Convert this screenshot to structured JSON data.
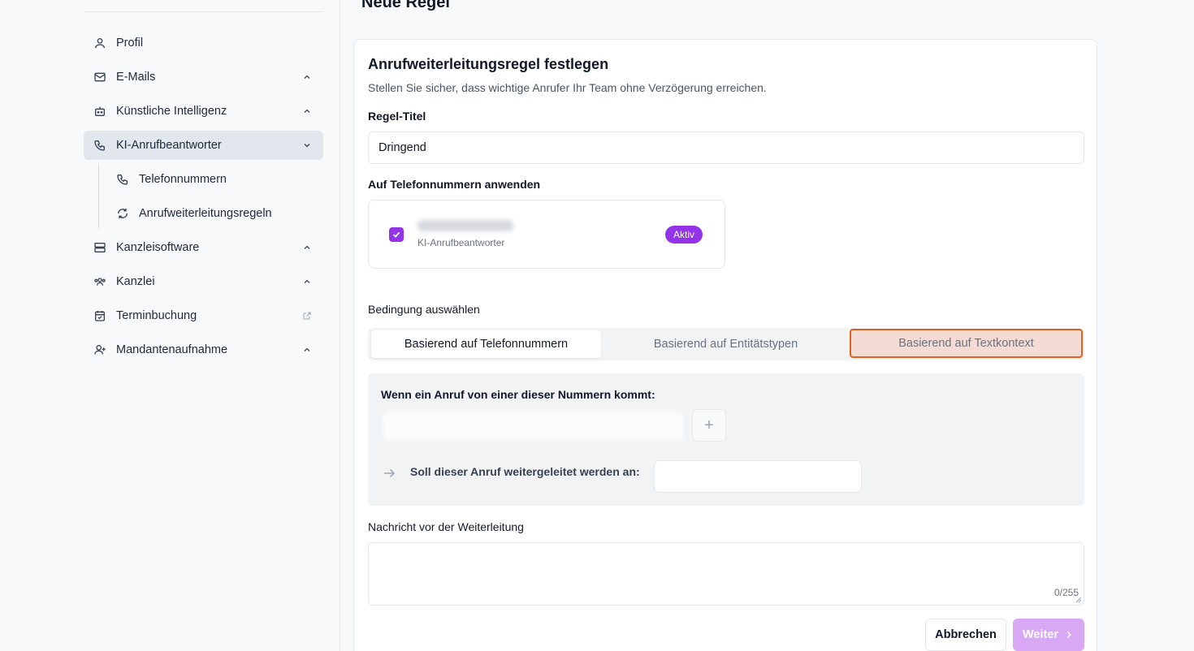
{
  "sidebar": {
    "items": [
      {
        "label": "Profil",
        "icon": "user-icon"
      },
      {
        "label": "E-Mails",
        "icon": "mail-icon"
      },
      {
        "label": "Künstliche Intelligenz",
        "icon": "bot-icon"
      },
      {
        "label": "KI-Anrufbeantworter",
        "icon": "phone-icon"
      },
      {
        "label": "Telefonnummern",
        "icon": "phone-icon"
      },
      {
        "label": "Anrufweiterleitungsregeln",
        "icon": "refresh-icon"
      },
      {
        "label": "Kanzleisoftware",
        "icon": "server-icon"
      },
      {
        "label": "Kanzlei",
        "icon": "users-icon"
      },
      {
        "label": "Terminbuchung",
        "icon": "calendar-check-icon"
      },
      {
        "label": "Mandantenaufnahme",
        "icon": "user-plus-icon"
      }
    ]
  },
  "page": {
    "title": "Neue Regel"
  },
  "form": {
    "title": "Anrufweiterleitungsregel festlegen",
    "subtitle": "Stellen Sie sicher, dass wichtige Anrufer Ihr Team ohne Verzögerung erreichen.",
    "rule_title_label": "Regel-Titel",
    "rule_title_value": "Dringend",
    "apply_label": "Auf Telefonnummern anwenden",
    "phone_entry": {
      "subtitle": "KI-Anrufbeantworter",
      "badge": "Aktiv",
      "checked": true
    },
    "condition_label": "Bedingung auswählen",
    "tabs": [
      {
        "label": "Basierend auf Telefonnummern"
      },
      {
        "label": "Basierend auf Entitätstypen"
      },
      {
        "label": "Basierend auf Textkontext"
      }
    ],
    "condition_box": {
      "heading": "Wenn ein Anruf von einer dieser Nummern kommt:",
      "plus": "+",
      "forward_label": "Soll dieser Anruf weitergeleitet werden an:"
    },
    "message_label": "Nachricht vor der Weiterleitung",
    "message_counter": "0/255",
    "cancel_label": "Abbrechen",
    "next_label": "Weiter"
  },
  "colors": {
    "accent": "#9333ea",
    "highlight_border": "#e0601f",
    "next_button": "#d8a8f5"
  }
}
